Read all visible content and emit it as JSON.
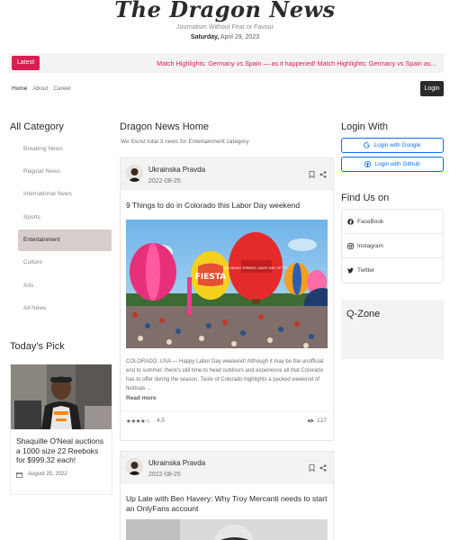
{
  "masthead": {
    "logo": "The Dragon News",
    "tagline": "Journalism Without Fear or Favour",
    "day": "Saturday,",
    "date": "April 29, 2023"
  },
  "ticker": {
    "latest_label": "Latest",
    "text": "Match Highlights: Germany vs Spain — as it happened! Match Highlights: Germany vs Spain as..."
  },
  "nav": {
    "links": [
      "Home",
      "About",
      "Career"
    ],
    "login_label": "Login"
  },
  "left": {
    "category_title": "All Category",
    "categories": [
      "Breaking News",
      "Regular News",
      "International News",
      "Sports",
      "Entertainment",
      "Culture",
      "Arts",
      "All News"
    ],
    "active_category": "Entertainment",
    "pick_title": "Today's Pick",
    "pick": {
      "headline": "Shaquille O'Neal auctions a 1000 size 22 Reeboks for $999.32 each!",
      "date": "August 25, 2022"
    }
  },
  "main": {
    "title": "Dragon News Home",
    "count_text": "We found total 3 news for Entertainment category",
    "cards": [
      {
        "author": "Ukrainska Pravda",
        "date": "2022-08-25",
        "title": "9 Things to do in Colorado this Labor Day weekend",
        "body": "COLORADO, USA — Happy Labor Day weekend! Although it may be the unofficial end to summer, there's still time to head outdoors and experience all that Colorado has to offer during the season. Taste of Colorado highlights a packed weekend of festivals ...",
        "read_more": "Read more",
        "rating": "4.5",
        "views": "127",
        "balloon_texts": [
          "FIESTA",
          "COLORADO SPRINGS LABOR DAY LIFT OFF"
        ]
      },
      {
        "author": "Ukrainska Pravda",
        "date": "2022-08-25",
        "title": "Up Late with Ben Havery: Why Troy Mercanti needs to start an OnlyFans account"
      }
    ]
  },
  "right": {
    "login_title": "Login With",
    "google_label": "Login with Google",
    "github_label": "Login with Github",
    "find_title": "Find Us on",
    "social": [
      "FaceBook",
      "Instagram",
      "Twitter"
    ],
    "qzone_title": "Q-Zone"
  },
  "colors": {
    "accent": "#d72050",
    "dark": "#2b2b2b",
    "muted": "#706f6f",
    "blue": "#0d6efd",
    "active_bg": "#d7cdcd",
    "panel_bg": "#f3f3f3"
  }
}
